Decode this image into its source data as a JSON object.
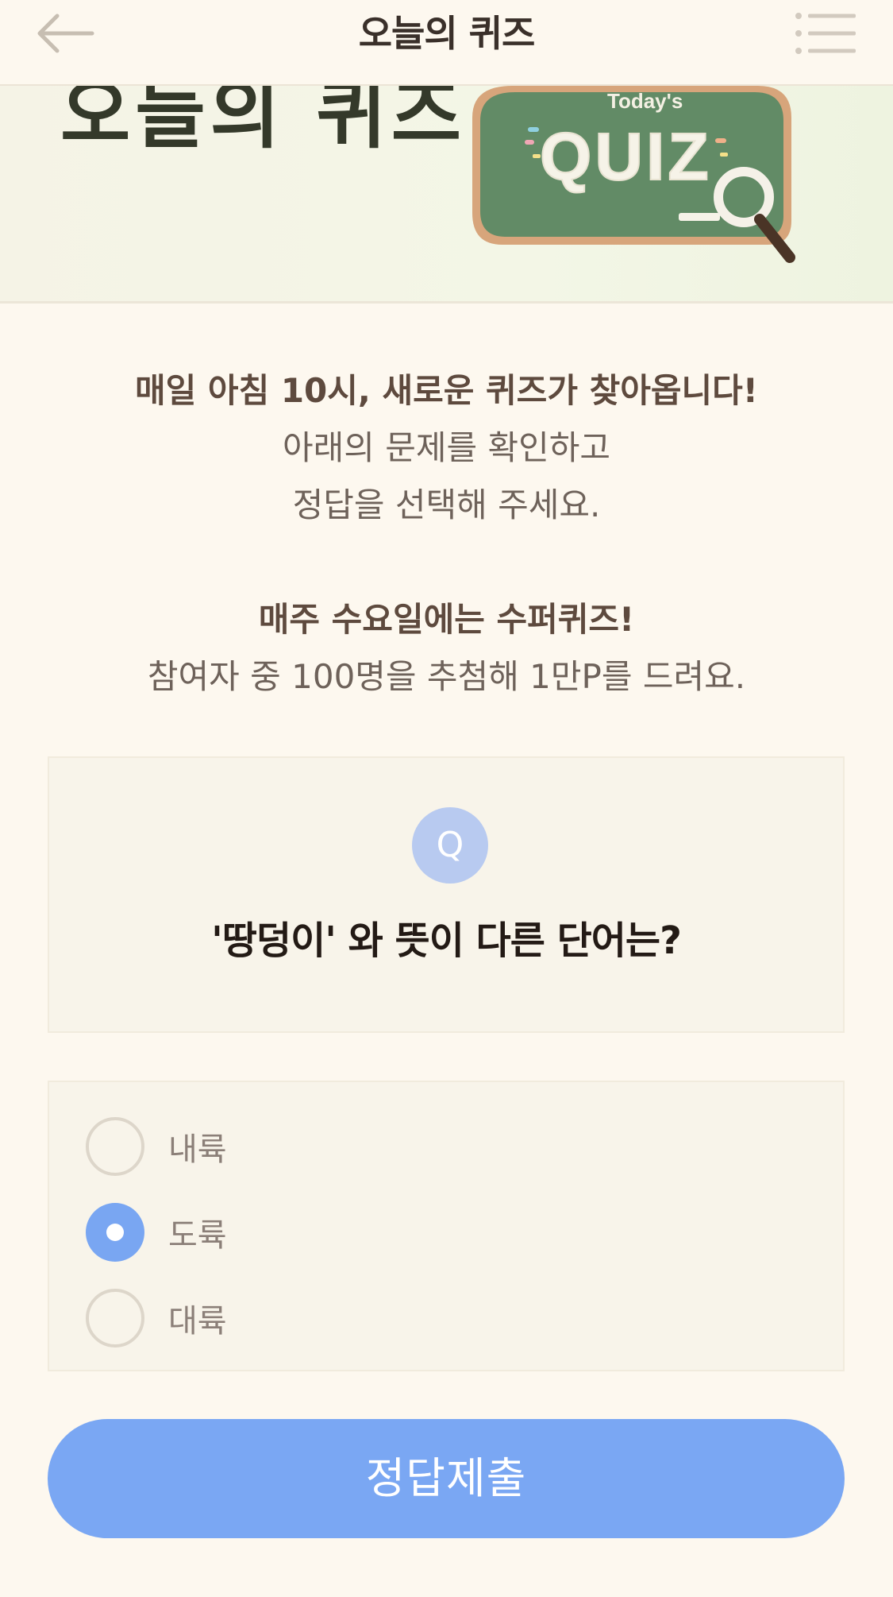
{
  "header": {
    "title": "오늘의 퀴즈",
    "back_icon": "arrow-left-icon",
    "menu_icon": "list-icon"
  },
  "banner": {
    "title": "오늘의 퀴즈",
    "board_small_text": "Today's",
    "board_big_text": "QUIZ"
  },
  "intro": {
    "line1": "매일 아침 10시, 새로운 퀴즈가 찾아옵니다!",
    "line2": "아래의 문제를 확인하고",
    "line3": "정답을 선택해 주세요.",
    "line4": "매주 수요일에는 수퍼퀴즈!",
    "line5": "참여자 중 100명을 추첨해 1만P를 드려요."
  },
  "question": {
    "badge": "Q",
    "text": "'땅덩이' 와 뜻이 다른 단어는?"
  },
  "options": [
    {
      "label": "내륙",
      "selected": false
    },
    {
      "label": "도륙",
      "selected": true
    },
    {
      "label": "대륙",
      "selected": false
    }
  ],
  "submit": {
    "label": "정답제출"
  },
  "colors": {
    "background": "#fdf8ef",
    "accent": "#7aa7f3",
    "q_badge": "#b8caf0"
  }
}
